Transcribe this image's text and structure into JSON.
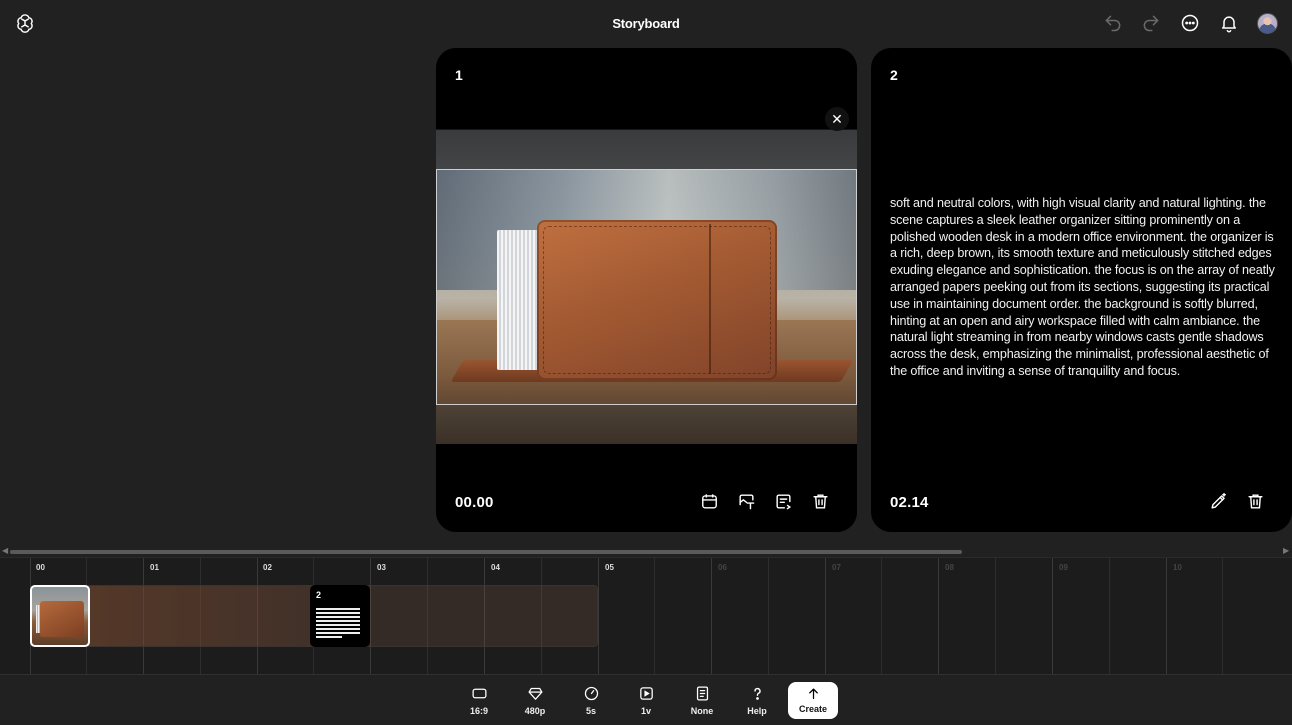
{
  "header": {
    "title": "Storyboard",
    "icons": [
      "openai-logo-icon",
      "undo-icon",
      "redo-icon",
      "more-icon",
      "bell-icon",
      "avatar"
    ]
  },
  "cards": [
    {
      "number": "1",
      "time": "00.00",
      "media": "image of brown leather desk organizer with papers",
      "tools": [
        "calendar-icon",
        "image-text-icon",
        "caption-icon",
        "trash-icon"
      ]
    },
    {
      "number": "2",
      "time": "02.14",
      "prompt": "soft and neutral colors, with high visual clarity and natural lighting. the scene captures a sleek leather organizer sitting prominently on a polished wooden desk in a modern office environment. the organizer is a rich, deep brown, its smooth texture and meticulously stitched edges exuding elegance and sophistication. the focus is on the array of neatly arranged papers peeking out from its sections, suggesting its practical use in maintaining document order. the background is softly blurred, hinting at an open and airy workspace filled with calm ambiance. the natural light streaming in from nearby windows casts gentle shadows across the desk, emphasizing the minimalist, professional aesthetic of the office and inviting a sense of tranquility and focus.",
      "tools": [
        "edit-pencil-icon",
        "trash-icon"
      ]
    }
  ],
  "timeline": {
    "labels": [
      "00",
      "01",
      "02",
      "03",
      "04",
      "05",
      "06",
      "07",
      "08",
      "09",
      "10"
    ],
    "clip2_label": "2"
  },
  "bottombar": {
    "aspect": "16:9",
    "resolution": "480p",
    "duration": "5s",
    "variations": "1v",
    "preset": "None",
    "help": "Help",
    "create": "Create"
  },
  "colors": {
    "background": "#212121",
    "card": "#000000",
    "timeline": "#1c1c1c",
    "create_button": "#ffffff"
  }
}
